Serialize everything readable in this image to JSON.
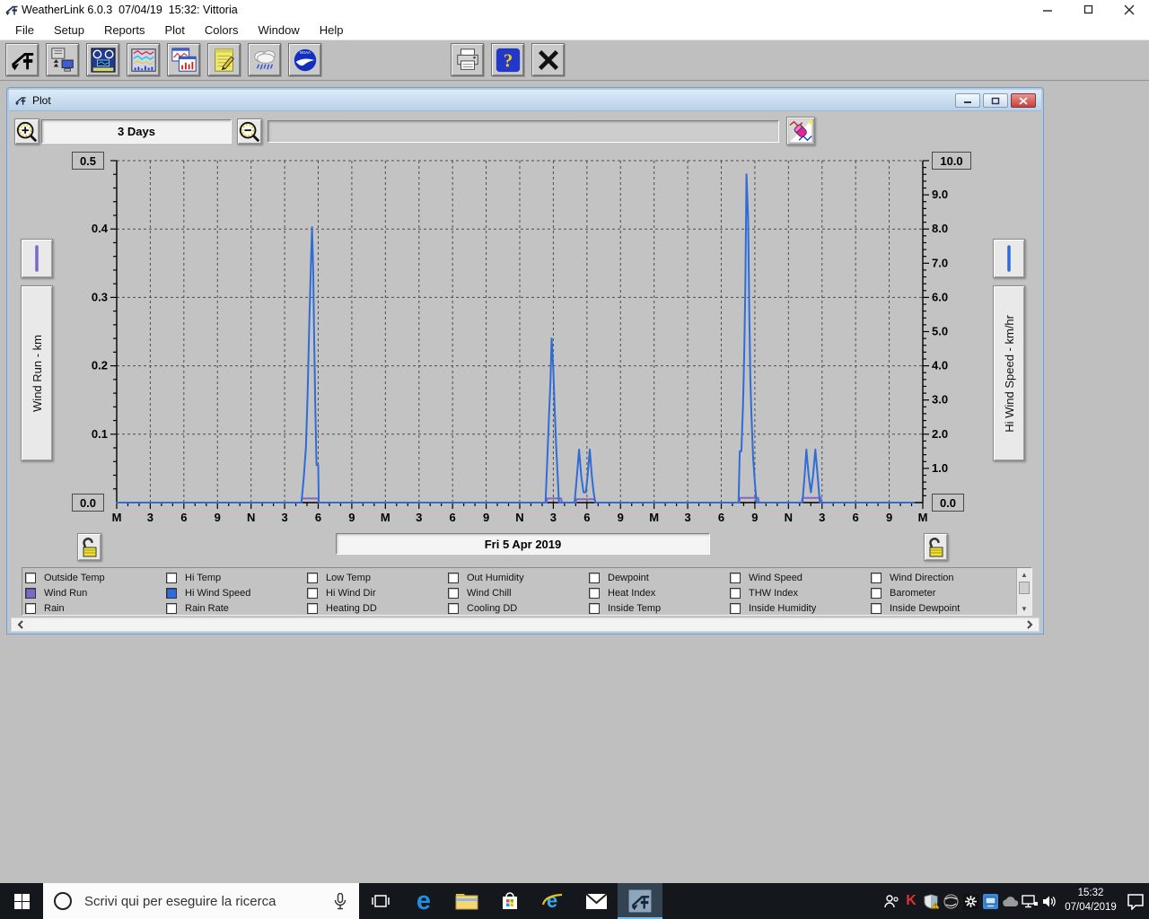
{
  "app": {
    "title": "WeatherLink 6.0.3  07/04/19  15:32: Vittoria",
    "menus": [
      "File",
      "Setup",
      "Reports",
      "Plot",
      "Colors",
      "Window",
      "Help"
    ]
  },
  "plot_window": {
    "title": "Plot",
    "range_label": "3 Days",
    "date_label": "Fri 5 Apr 2019"
  },
  "chart_data": {
    "type": "line",
    "time_span": "3 Days",
    "x_axis": {
      "span_hours": 72,
      "major_tick_hours": 3,
      "minor_tick_hours": 1,
      "labels": [
        "M",
        "3",
        "6",
        "9",
        "N",
        "3",
        "6",
        "9",
        "M",
        "3",
        "6",
        "9",
        "N",
        "3",
        "6",
        "9",
        "M",
        "3",
        "6",
        "9",
        "N",
        "3",
        "6",
        "9",
        "M"
      ]
    },
    "left_axis": {
      "label": "Wind Run - km",
      "min": 0,
      "max": 0.5,
      "boxed_max": "0.5",
      "boxed_min": "0.0",
      "tick_labels": [
        "0.4",
        "0.3",
        "0.2",
        "0.1"
      ],
      "minor_step": 0.02,
      "series_color": "#7b68c8"
    },
    "right_axis": {
      "label": "Hi Wind Speed - km/hr",
      "min": 0,
      "max": 10,
      "boxed_max": "10.0",
      "boxed_min": "0.0",
      "tick_labels": [
        "9.0",
        "8.0",
        "7.0",
        "6.0",
        "5.0",
        "4.0",
        "3.0",
        "2.0",
        "1.0"
      ],
      "minor_step": 0.2,
      "series_color": "#2f6cd8"
    },
    "grid": "dashed; vertical every 3h, horizontal every 0.1 km / 2.0 km-hr",
    "series": [
      {
        "name": "Wind Run",
        "axis": "left",
        "color": "#7b68c8",
        "points": [
          [
            0,
            0
          ],
          [
            16.5,
            0
          ],
          [
            16.55,
            0.006
          ],
          [
            18,
            0.006
          ],
          [
            18.05,
            0
          ],
          [
            38.4,
            0
          ],
          [
            38.45,
            0.006
          ],
          [
            39.7,
            0.006
          ],
          [
            39.75,
            0
          ],
          [
            41,
            0
          ],
          [
            41.05,
            0.005
          ],
          [
            42.7,
            0.005
          ],
          [
            42.75,
            0
          ],
          [
            55.6,
            0
          ],
          [
            55.65,
            0.007
          ],
          [
            57.3,
            0.007
          ],
          [
            57.35,
            0
          ],
          [
            61.2,
            0
          ],
          [
            61.25,
            0.007
          ],
          [
            62.9,
            0.007
          ],
          [
            62.95,
            0
          ],
          [
            71.2,
            0
          ]
        ]
      },
      {
        "name": "Hi Wind Speed",
        "axis": "right",
        "color": "#2f6cd8",
        "points": [
          [
            0,
            0
          ],
          [
            16.5,
            0
          ],
          [
            16.7,
            0.7
          ],
          [
            16.9,
            1.6
          ],
          [
            17.05,
            3.2
          ],
          [
            17.2,
            5.2
          ],
          [
            17.35,
            7
          ],
          [
            17.45,
            8.05
          ],
          [
            17.55,
            6.8
          ],
          [
            17.65,
            4.6
          ],
          [
            17.75,
            2.6
          ],
          [
            17.85,
            1.1
          ],
          [
            18,
            1.1
          ],
          [
            18.05,
            0
          ],
          [
            38.3,
            0
          ],
          [
            38.45,
            1.2
          ],
          [
            38.6,
            2.4
          ],
          [
            38.75,
            3.6
          ],
          [
            38.85,
            4.8
          ],
          [
            39,
            3.9
          ],
          [
            39.1,
            2.9
          ],
          [
            39.25,
            1.7
          ],
          [
            39.4,
            0.7
          ],
          [
            39.5,
            0
          ],
          [
            40.9,
            0
          ],
          [
            41.1,
            0.75
          ],
          [
            41.3,
            1.55
          ],
          [
            41.5,
            0.75
          ],
          [
            41.7,
            0.3
          ],
          [
            41.9,
            0.3
          ],
          [
            42.05,
            0.75
          ],
          [
            42.25,
            1.55
          ],
          [
            42.45,
            0.75
          ],
          [
            42.6,
            0.3
          ],
          [
            42.75,
            0
          ],
          [
            55.55,
            0
          ],
          [
            55.65,
            1.5
          ],
          [
            55.8,
            1.5
          ],
          [
            55.95,
            2.9
          ],
          [
            56.05,
            4.4
          ],
          [
            56.15,
            6.3
          ],
          [
            56.25,
            9.6
          ],
          [
            56.4,
            8.3
          ],
          [
            56.5,
            5.6
          ],
          [
            56.6,
            3.6
          ],
          [
            56.7,
            2.5
          ],
          [
            56.85,
            1.3
          ],
          [
            57,
            0.6
          ],
          [
            57.15,
            0
          ],
          [
            61.25,
            0
          ],
          [
            61.45,
            0.8
          ],
          [
            61.6,
            1.55
          ],
          [
            61.8,
            0.8
          ],
          [
            62,
            0.3
          ],
          [
            62.2,
            0.8
          ],
          [
            62.4,
            1.55
          ],
          [
            62.6,
            0.8
          ],
          [
            62.8,
            0
          ],
          [
            71.2,
            0
          ]
        ]
      }
    ]
  },
  "legend": {
    "columns": [
      [
        {
          "label": "Outside Temp",
          "checked": false
        },
        {
          "label": "Wind Run",
          "checked": true,
          "color": "#7b68c8"
        },
        {
          "label": "Rain",
          "checked": false
        }
      ],
      [
        {
          "label": "Hi Temp",
          "checked": false
        },
        {
          "label": "Hi Wind Speed",
          "checked": true,
          "color": "#2f6cd8"
        },
        {
          "label": "Rain Rate",
          "checked": false
        }
      ],
      [
        {
          "label": "Low Temp",
          "checked": false
        },
        {
          "label": "Hi Wind Dir",
          "checked": false
        },
        {
          "label": "Heating DD",
          "checked": false
        }
      ],
      [
        {
          "label": "Out Humidity",
          "checked": false
        },
        {
          "label": "Wind Chill",
          "checked": false
        },
        {
          "label": "Cooling DD",
          "checked": false
        }
      ],
      [
        {
          "label": "Dewpoint",
          "checked": false
        },
        {
          "label": "Heat Index",
          "checked": false
        },
        {
          "label": "Inside Temp",
          "checked": false
        }
      ],
      [
        {
          "label": "Wind Speed",
          "checked": false
        },
        {
          "label": "THW Index",
          "checked": false
        },
        {
          "label": "Inside Humidity",
          "checked": false
        }
      ],
      [
        {
          "label": "Wind Direction",
          "checked": false
        },
        {
          "label": "Barometer",
          "checked": false
        },
        {
          "label": "Inside Dewpoint",
          "checked": false
        }
      ]
    ]
  },
  "taskbar": {
    "search_placeholder": "Scrivi qui per eseguire la ricerca",
    "clock": {
      "time": "15:32",
      "date": "07/04/2019"
    }
  }
}
